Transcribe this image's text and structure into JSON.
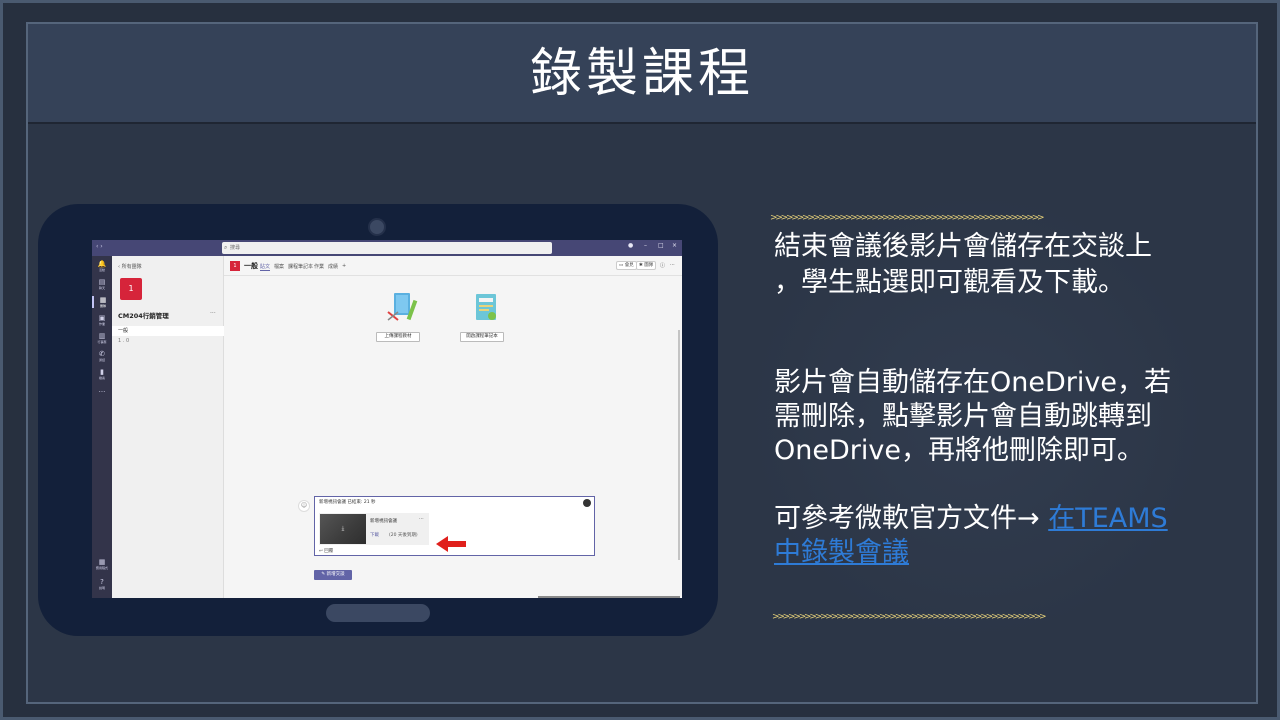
{
  "slide": {
    "title": "錄製課程",
    "chevrons_top": ">>>>>>>>>>>>>>>>>>>>>>>>>>>>>>>>>>>>>>>>>>>>>>>>>>>",
    "chevrons_bottom": ">>>>>>>>>>>>>>>>>>>>>>>>>>>>>>>>>>>>>>>>>>>>>>>>>>>",
    "para1_line1": "結束會議後影片會儲存在交談上",
    "para1_line2": "，學生點選即可觀看及下載。",
    "para2_line1": "影片會自動儲存在OneDrive，若",
    "para2_line2": "需刪除，點擊影片會自動跳轉到",
    "para2_line3": "OneDrive，再將他刪除即可。",
    "para3_prefix": "可參考微軟官方文件→ ",
    "para3_link_line1": "在TEAMS",
    "para3_link_line2": "中錄製會議"
  },
  "teams": {
    "nav": "‹ ›",
    "search_placeholder": "搜尋",
    "window_controls": [
      "–",
      "□",
      "×"
    ],
    "rail": [
      {
        "icon": "bell-icon",
        "glyph": "🔔",
        "label": "活動"
      },
      {
        "icon": "chat-icon",
        "glyph": "▤",
        "label": "聊天"
      },
      {
        "icon": "teams-icon",
        "glyph": "▦",
        "label": "團隊"
      },
      {
        "icon": "assignments-icon",
        "glyph": "▣",
        "label": "作業"
      },
      {
        "icon": "calendar-icon",
        "glyph": "▥",
        "label": "行事曆"
      },
      {
        "icon": "calls-icon",
        "glyph": "✆",
        "label": "通話"
      },
      {
        "icon": "files-icon",
        "glyph": "▮",
        "label": "檔案"
      },
      {
        "icon": "more-icon",
        "glyph": "···",
        "label": ""
      }
    ],
    "rail_bottom": [
      {
        "icon": "apps-icon",
        "glyph": "▦",
        "label": "應用程式"
      },
      {
        "icon": "help-icon",
        "glyph": "?",
        "label": "說明"
      }
    ],
    "team_panel": {
      "back": "‹ 所有團隊",
      "tile": "1",
      "name": "CM204行銷管理",
      "more": "···",
      "channel": "一般",
      "channel2": "1 . 0"
    },
    "main": {
      "tile": "1",
      "title": "一般",
      "tabs": [
        "貼文",
        "檔案",
        "課程筆記本",
        "作業",
        "成績",
        "+"
      ],
      "meet_label": "會見",
      "team_label": "團隊",
      "illus_btn1": "上傳課程教材",
      "illus_btn2": "開啟課程筆記本",
      "card_header": "新增視訊會議 已結束: 21 秒",
      "rec_name": "新增視訊會議",
      "rec_download": "下載",
      "rec_expire": "(20 天後到期)",
      "reply": "↩ 回覆",
      "new_conversation": "新增交談",
      "rec_dots": "···"
    }
  },
  "colors": {
    "teams_purple": "#6264a7",
    "team_tile_red": "#d6243a",
    "chevron_gold": "#e9d37a",
    "link_blue": "#2e7bd6",
    "arrow_red": "#e0201c"
  }
}
